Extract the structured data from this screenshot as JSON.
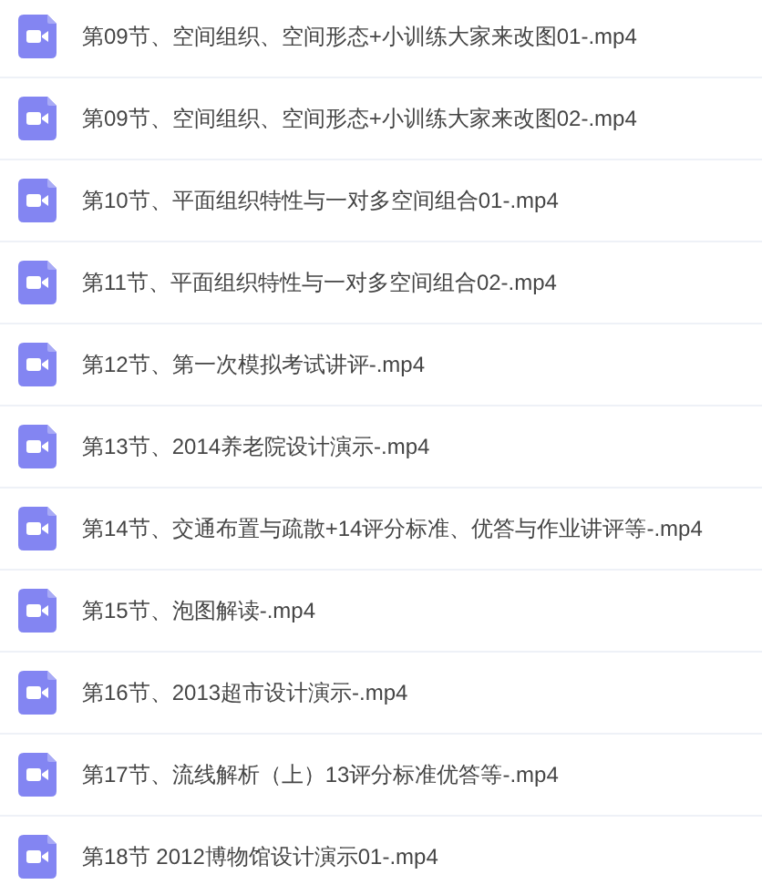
{
  "files": [
    {
      "name": "第09节、空间组织、空间形态+小训练大家来改图01-.mp4"
    },
    {
      "name": "第09节、空间组织、空间形态+小训练大家来改图02-.mp4"
    },
    {
      "name": "第10节、平面组织特性与一对多空间组合01-.mp4"
    },
    {
      "name": "第11节、平面组织特性与一对多空间组合02-.mp4"
    },
    {
      "name": "第12节、第一次模拟考试讲评-.mp4"
    },
    {
      "name": "第13节、2014养老院设计演示-.mp4"
    },
    {
      "name": "第14节、交通布置与疏散+14评分标准、优答与作业讲评等-.mp4"
    },
    {
      "name": "第15节、泡图解读-.mp4"
    },
    {
      "name": "第16节、2013超市设计演示-.mp4"
    },
    {
      "name": "第17节、流线解析（上）13评分标准优答等-.mp4"
    },
    {
      "name": "第18节 2012博物馆设计演示01-.mp4"
    }
  ]
}
